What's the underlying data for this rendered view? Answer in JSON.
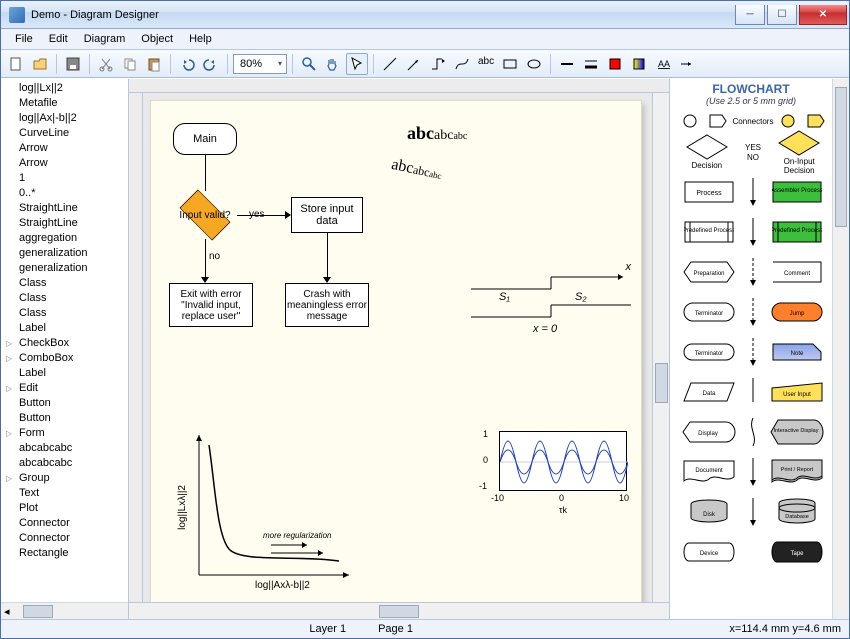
{
  "window": {
    "title": "Demo - Diagram Designer"
  },
  "menubar": [
    "File",
    "Edit",
    "Diagram",
    "Object",
    "Help"
  ],
  "toolbar": {
    "zoom_value": "80%"
  },
  "left_tree": {
    "items": [
      {
        "label": "log||Lx||2"
      },
      {
        "label": "Metafile"
      },
      {
        "label": "log||Ax|-b||2"
      },
      {
        "label": "CurveLine"
      },
      {
        "label": "Arrow"
      },
      {
        "label": "Arrow"
      },
      {
        "label": "1"
      },
      {
        "label": "0..*"
      },
      {
        "label": "StraightLine"
      },
      {
        "label": "StraightLine"
      },
      {
        "label": "aggregation"
      },
      {
        "label": "generalization"
      },
      {
        "label": "generalization"
      },
      {
        "label": "Class"
      },
      {
        "label": "Class"
      },
      {
        "label": "Class"
      },
      {
        "label": "Label"
      },
      {
        "label": "CheckBox",
        "expandable": true
      },
      {
        "label": "ComboBox",
        "expandable": true
      },
      {
        "label": "Label"
      },
      {
        "label": "Edit",
        "expandable": true
      },
      {
        "label": "Button"
      },
      {
        "label": "Button"
      },
      {
        "label": "Form",
        "expandable": true
      },
      {
        "label": "abcabcabc"
      },
      {
        "label": "abcabcabc"
      },
      {
        "label": "Group",
        "expandable": true
      },
      {
        "label": "Text"
      },
      {
        "label": "Plot"
      },
      {
        "label": "Connector"
      },
      {
        "label": "Connector"
      },
      {
        "label": "Rectangle"
      }
    ]
  },
  "canvas": {
    "flowchart": {
      "main": "Main",
      "decision": "Input valid?",
      "yes": "yes",
      "no": "no",
      "store": "Store input data",
      "exit": "Exit with error \"Invalid input, replace user\"",
      "crash": "Crash with meaningless error message"
    },
    "text_samples": {
      "t1_a": "abc",
      "t1_b": "abc",
      "t1_c": "abc",
      "t2_a": "abc",
      "t2_b": "abc",
      "t2_c": "abc"
    },
    "step": {
      "s1": "S₁",
      "s2": "S₂",
      "x": "x",
      "x0": "x = 0"
    },
    "decaychart": {
      "ylabel": "log||Lxλ||2",
      "xlabel": "log||Axλ-b||2",
      "annot": "more regularization"
    },
    "sine": {
      "y_ticks": [
        "1",
        "0",
        "-1"
      ],
      "x_ticks": [
        "-10",
        "0",
        "10"
      ],
      "x_sub": "τk"
    }
  },
  "chart_data": [
    {
      "type": "line",
      "title": "",
      "xlabel": "τk",
      "ylabel": "",
      "xlim": [
        -10,
        10
      ],
      "ylim": [
        -1,
        1
      ],
      "x_ticks": [
        -10,
        0,
        10
      ],
      "y_ticks": [
        -1,
        0,
        1
      ],
      "series": [
        {
          "name": "sine",
          "x": [
            -10,
            -9,
            -8,
            -7,
            -6,
            -5,
            -4,
            -3,
            -2,
            -1,
            0,
            1,
            2,
            3,
            4,
            5,
            6,
            7,
            8,
            9,
            10
          ],
          "values": [
            0.54,
            -0.41,
            -0.99,
            -0.66,
            0.28,
            0.96,
            0.76,
            -0.14,
            -0.91,
            -0.84,
            0.0,
            0.84,
            0.91,
            0.14,
            -0.76,
            -0.96,
            -0.28,
            0.66,
            0.99,
            0.41,
            -0.54
          ]
        }
      ]
    },
    {
      "type": "line",
      "title": "",
      "xlabel": "log||Axλ-b||2",
      "ylabel": "log||Lxλ||2",
      "annotations": [
        "more regularization"
      ],
      "series": [
        {
          "name": "L-curve",
          "x": [
            0.05,
            0.07,
            0.08,
            0.09,
            0.1,
            0.11,
            0.13,
            0.18,
            0.3,
            0.55,
            0.85,
            0.95
          ],
          "values": [
            0.95,
            0.8,
            0.55,
            0.35,
            0.22,
            0.15,
            0.11,
            0.08,
            0.06,
            0.055,
            0.07,
            0.085
          ]
        }
      ]
    }
  ],
  "palette": {
    "title": "FLOWCHART",
    "subtitle": "(Use 2.5 or 5 mm grid)",
    "connectors_label": "Connectors",
    "decision": "Decision",
    "yes": "YES",
    "no": "NO",
    "oninput": "On-Input Decision",
    "process": "Process",
    "assembler": "Assembler Process",
    "predef": "Predefined Process",
    "predef2": "Predefined Process",
    "prep": "Preparation",
    "comment": "Comment",
    "term1": "Terminator",
    "jump": "Jump",
    "term2": "Terminator",
    "note": "Note",
    "data": "Data",
    "userinput": "User Input",
    "display": "Display",
    "interactive": "Interactive Display",
    "document": "Document",
    "print": "Print / Report",
    "disk": "Disk",
    "database": "Database",
    "device": "Device",
    "tape": "Tape"
  },
  "status": {
    "layer": "Layer 1",
    "page": "Page 1",
    "coords": "x=114.4 mm  y=4.6 mm"
  }
}
